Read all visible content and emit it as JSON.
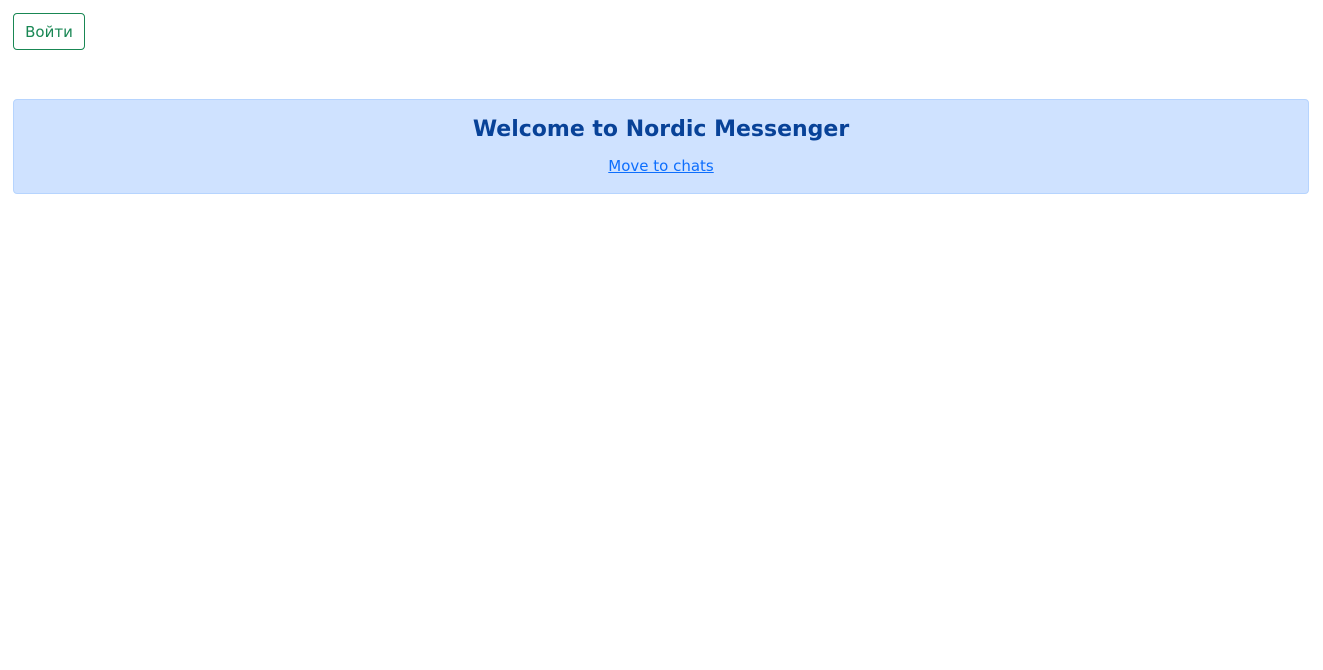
{
  "header": {
    "login_label": "Войти"
  },
  "welcome": {
    "title": "Welcome to Nordic Messenger",
    "link_label": "Move to chats"
  },
  "colors": {
    "login_border": "#198754",
    "alert_background": "#cfe2ff",
    "alert_border": "#b6d4fe",
    "title_color": "#084298",
    "link_color": "#0d6efd"
  }
}
